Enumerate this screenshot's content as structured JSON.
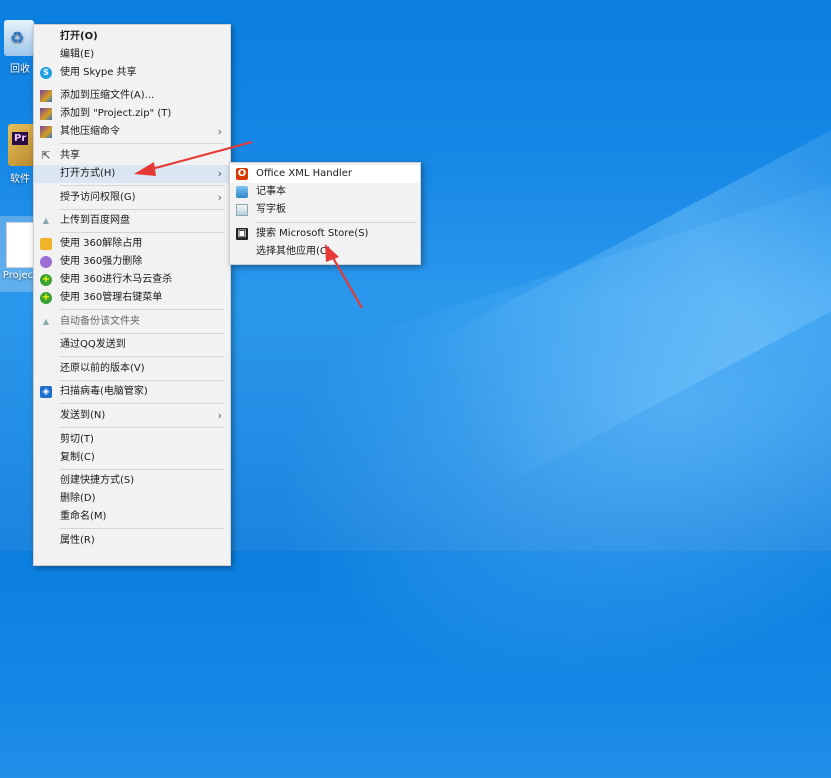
{
  "desktop": {
    "icons": [
      {
        "label": "回收",
        "icon": "recycle-bin-icon"
      },
      {
        "label": "软件",
        "icon": "folder-icon"
      },
      {
        "label": "Project",
        "icon": "file-icon"
      }
    ]
  },
  "context_menu": {
    "items": [
      {
        "label": "打开(O)",
        "bold": true
      },
      {
        "label": "编辑(E)"
      },
      {
        "label": "使用 Skype 共享",
        "icon": "skype-icon"
      },
      {
        "label": "添加到压缩文件(A)...",
        "icon": "winrar-icon"
      },
      {
        "label": "添加到 \"Project.zip\" (T)",
        "icon": "winrar-icon"
      },
      {
        "label": "其他压缩命令",
        "icon": "winrar-icon",
        "submenu": true
      },
      {
        "label": "共享",
        "icon": "share-icon"
      },
      {
        "label": "打开方式(H)",
        "submenu": true,
        "highlighted": true
      },
      {
        "label": "授予访问权限(G)",
        "submenu": true
      },
      {
        "label": "上传到百度网盘",
        "icon": "baidu-cloud-icon"
      },
      {
        "label": "使用 360解除占用",
        "icon": "360-unlock-icon"
      },
      {
        "label": "使用 360强力删除",
        "icon": "360-delete-icon"
      },
      {
        "label": "使用 360进行木马云查杀",
        "icon": "360-scan-icon"
      },
      {
        "label": "使用 360管理右键菜单",
        "icon": "360-menu-icon"
      },
      {
        "label": "自动备份该文件夹",
        "icon": "backup-icon"
      },
      {
        "label": "通过QQ发送到"
      },
      {
        "label": "还原以前的版本(V)"
      },
      {
        "label": "扫描病毒(电脑管家)",
        "icon": "shield-icon"
      },
      {
        "label": "发送到(N)",
        "submenu": true
      },
      {
        "label": "剪切(T)"
      },
      {
        "label": "复制(C)"
      },
      {
        "label": "创建快捷方式(S)"
      },
      {
        "label": "删除(D)"
      },
      {
        "label": "重命名(M)"
      },
      {
        "label": "属性(R)"
      }
    ]
  },
  "open_with_submenu": {
    "items": [
      {
        "label": "Office XML Handler",
        "icon": "office-icon",
        "highlighted": true
      },
      {
        "label": "记事本",
        "icon": "notepad-icon"
      },
      {
        "label": "写字板",
        "icon": "wordpad-icon"
      },
      {
        "label": "搜索 Microsoft Store(S)",
        "icon": "store-icon"
      },
      {
        "label": "选择其他应用(C)"
      }
    ]
  },
  "colors": {
    "desktop": "#1788e6",
    "menu_bg": "#f2f2f2",
    "highlight": "#dbe6f3",
    "annotation_arrow": "#e53935"
  }
}
